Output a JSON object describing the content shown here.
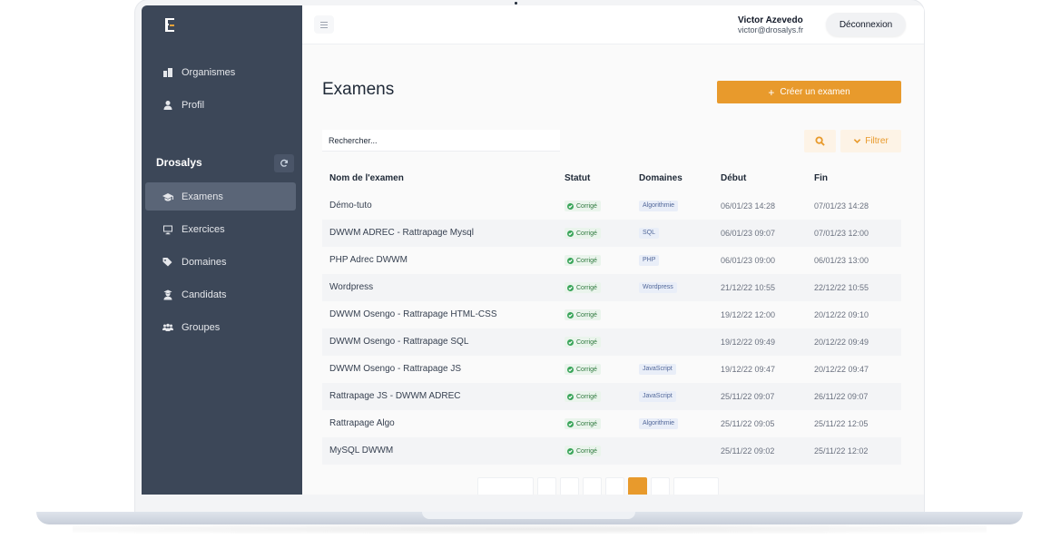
{
  "sidebar": {
    "nav_top": [
      {
        "label": "Organismes",
        "icon": "building-icon"
      },
      {
        "label": "Profil",
        "icon": "user-icon"
      }
    ],
    "section_title": "Drosalys",
    "nav_section": [
      {
        "label": "Examens",
        "icon": "graduation-cap-icon",
        "active": true
      },
      {
        "label": "Exercices",
        "icon": "monitor-icon"
      },
      {
        "label": "Domaines",
        "icon": "tags-icon"
      },
      {
        "label": "Candidats",
        "icon": "user-graduate-icon"
      },
      {
        "label": "Groupes",
        "icon": "users-icon"
      }
    ]
  },
  "topbar": {
    "user_name": "Victor Azevedo",
    "user_email": "victor@drosalys.fr",
    "logout_label": "Déconnexion"
  },
  "main": {
    "title": "Examens",
    "create_label": "Créer un examen",
    "search_placeholder": "Rechercher...",
    "filter_label": "Filtrer",
    "columns": [
      "Nom de l'examen",
      "Statut",
      "Domaines",
      "Début",
      "Fin"
    ],
    "rows": [
      {
        "name": "Démo-tuto",
        "status": "Corrigé",
        "domain": "Algorithmie",
        "start": "06/01/23 14:28",
        "end": "07/01/23 14:28"
      },
      {
        "name": "DWWM ADREC - Rattrapage Mysql",
        "status": "Corrigé",
        "domain": "SQL",
        "start": "06/01/23 09:07",
        "end": "07/01/23 12:00"
      },
      {
        "name": "PHP Adrec DWWM",
        "status": "Corrigé",
        "domain": "PHP",
        "start": "06/01/23 09:00",
        "end": "06/01/23 13:00"
      },
      {
        "name": "Wordpress",
        "status": "Corrigé",
        "domain": "Wordpress",
        "start": "21/12/22 10:55",
        "end": "22/12/22 10:55"
      },
      {
        "name": "DWWM Osengo - Rattrapage HTML-CSS",
        "status": "Corrigé",
        "domain": "",
        "start": "19/12/22 12:00",
        "end": "20/12/22 09:10"
      },
      {
        "name": "DWWM Osengo - Rattrapage SQL",
        "status": "Corrigé",
        "domain": "",
        "start": "19/12/22 09:49",
        "end": "20/12/22 09:49"
      },
      {
        "name": "DWWM Osengo - Rattrapage JS",
        "status": "Corrigé",
        "domain": "JavaScript",
        "start": "19/12/22 09:47",
        "end": "20/12/22 09:47"
      },
      {
        "name": "Rattrapage JS - DWWM ADREC",
        "status": "Corrigé",
        "domain": "JavaScript",
        "start": "25/11/22 09:07",
        "end": "26/11/22 09:07"
      },
      {
        "name": "Rattrapage Algo",
        "status": "Corrigé",
        "domain": "Algorithmie",
        "start": "25/11/22 09:05",
        "end": "25/11/22 12:05"
      },
      {
        "name": "MySQL DWWM",
        "status": "Corrigé",
        "domain": "",
        "start": "25/11/22 09:02",
        "end": "25/11/22 12:02"
      }
    ]
  },
  "colors": {
    "sidebar_bg": "#3c4758",
    "accent": "#e89a2c",
    "status_green": "#3aa55a"
  }
}
